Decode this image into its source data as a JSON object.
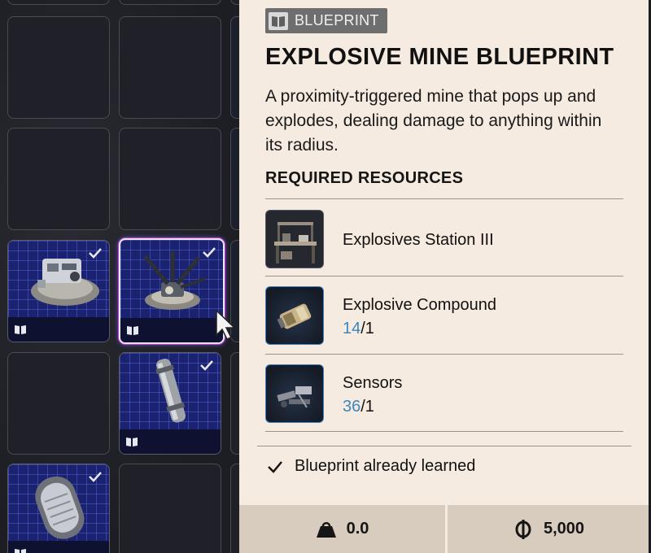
{
  "tooltip": {
    "badge": "BLUEPRINT",
    "title": "EXPLOSIVE MINE BLUEPRINT",
    "description": "A proximity-triggered mine that pops up and explodes, dealing damage to anything within its radius.",
    "required_header": "REQUIRED RESOURCES",
    "resources": [
      {
        "name": "Explosives Station III",
        "icon": "workbench-icon"
      },
      {
        "name": "Explosive Compound",
        "have": "14",
        "need": "/1",
        "icon": "explosive-compound-icon"
      },
      {
        "name": "Sensors",
        "have": "36",
        "need": "/1",
        "icon": "sensors-icon"
      }
    ],
    "learned_text": "Blueprint already learned",
    "weight": "0.0",
    "price": "5,000"
  },
  "colors": {
    "panel_bg": "#f5ebe0",
    "footer_bg": "#d8ccbe",
    "quantity_have": "#3b87bf",
    "blueprint_slot": "#1b2270",
    "selection_glow": "#c23bd9"
  },
  "inventory": {
    "slots": [
      {
        "state": "empty"
      },
      {
        "state": "empty"
      },
      {
        "state": "empty"
      },
      {
        "state": "empty"
      },
      {
        "state": "blueprint",
        "item": "turret-mine-blueprint-icon",
        "learned": true
      },
      {
        "state": "blueprint",
        "item": "explosive-mine-blueprint-icon",
        "learned": true,
        "selected": true
      },
      {
        "state": "empty"
      },
      {
        "state": "blueprint",
        "item": "pipe-blueprint-icon",
        "learned": true
      },
      {
        "state": "blueprint",
        "item": "capsule-blueprint-icon",
        "learned": true
      },
      {
        "state": "empty"
      }
    ]
  }
}
